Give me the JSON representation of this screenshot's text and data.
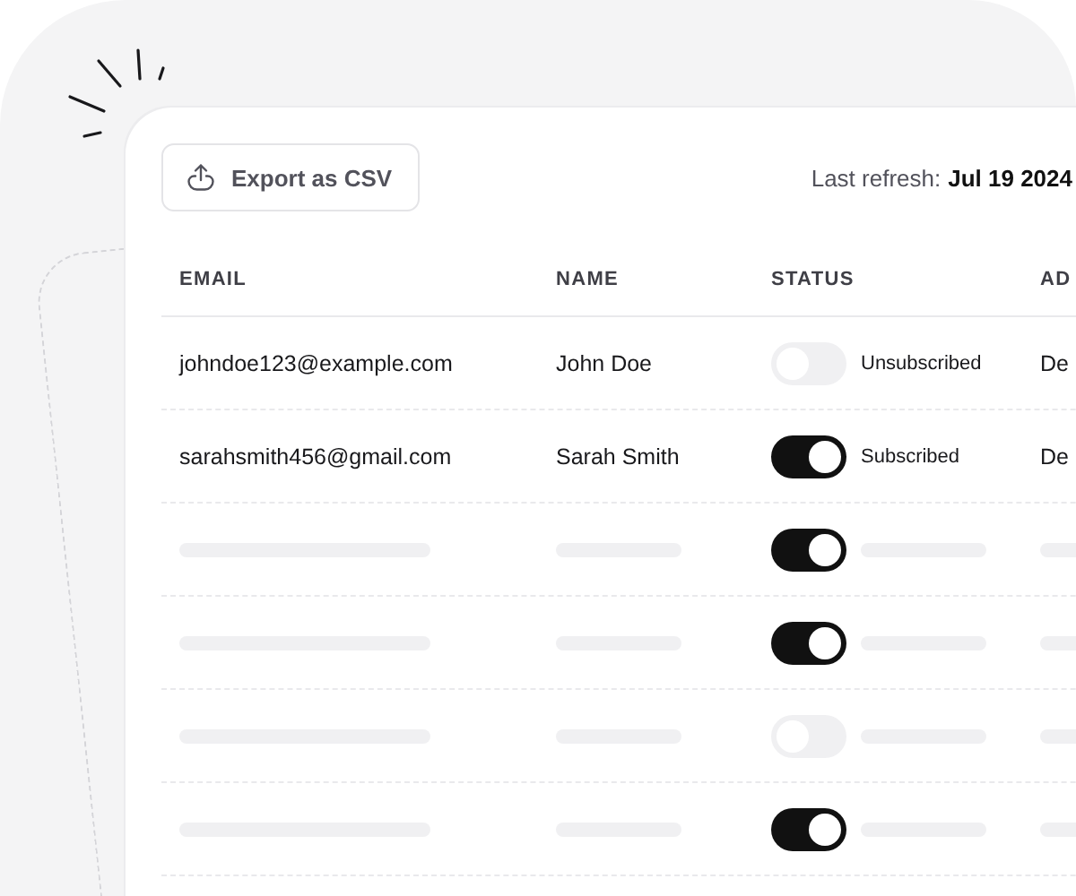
{
  "toolbar": {
    "export_button": "Export as CSV",
    "refresh_label": "Last refresh:",
    "refresh_date": "Jul 19 2024"
  },
  "table": {
    "columns": [
      "EMAIL",
      "NAME",
      "STATUS",
      "AD"
    ],
    "rows": [
      {
        "kind": "data",
        "email": "johndoe123@example.com",
        "name": "John Doe",
        "on": false,
        "status": "Unsubscribed",
        "added": "De"
      },
      {
        "kind": "data",
        "email": "sarahsmith456@gmail.com",
        "name": "Sarah Smith",
        "on": true,
        "status": "Subscribed",
        "added": "De"
      },
      {
        "kind": "skeleton",
        "on": true
      },
      {
        "kind": "skeleton",
        "on": true
      },
      {
        "kind": "skeleton",
        "on": false
      },
      {
        "kind": "skeleton",
        "on": true
      }
    ]
  }
}
